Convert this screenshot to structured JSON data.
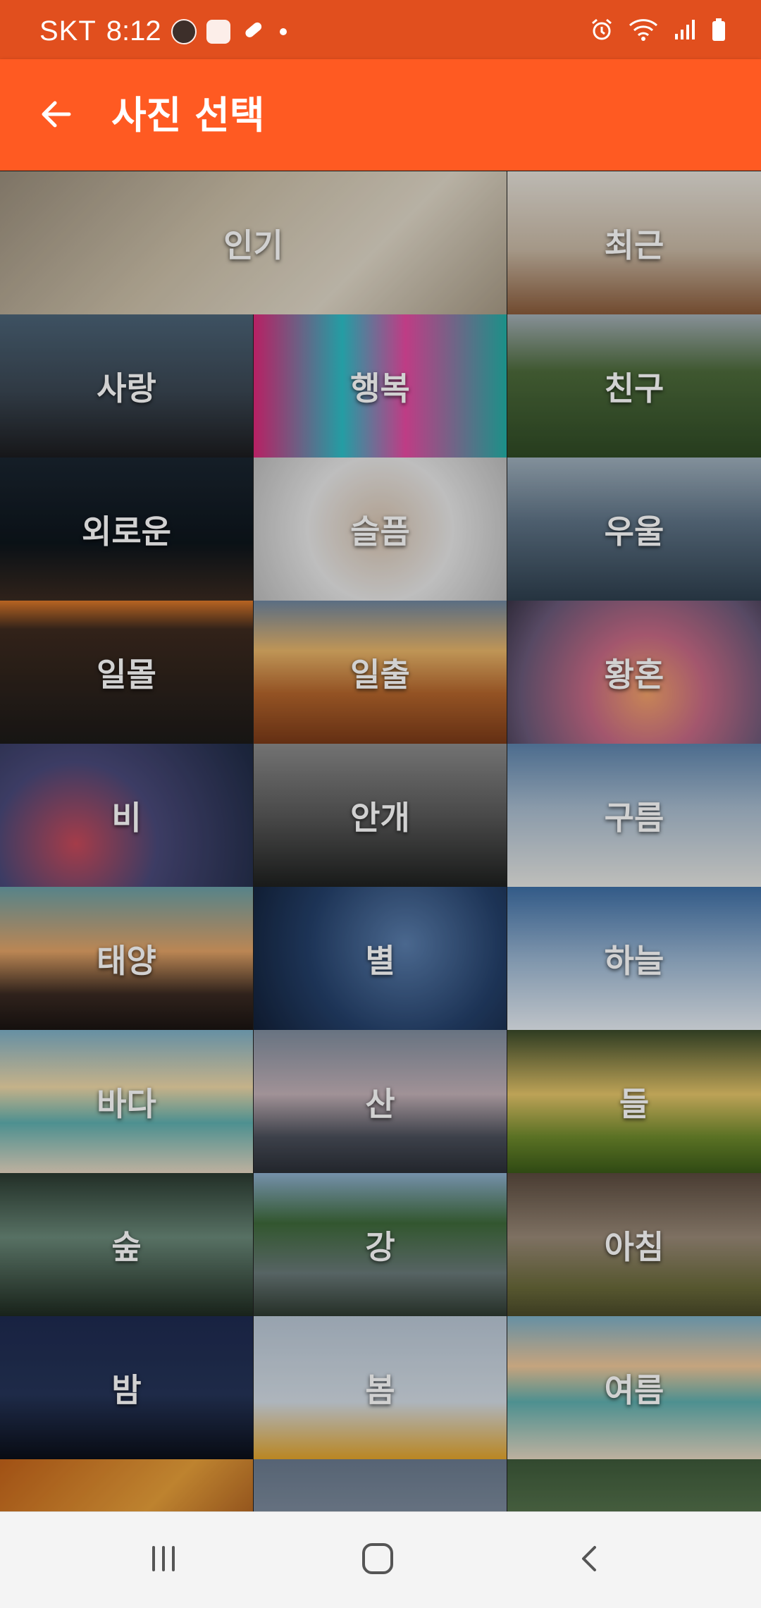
{
  "status_bar": {
    "carrier": "SKT",
    "time": "8:12"
  },
  "app_bar": {
    "title": "사진 선택",
    "back_icon": "arrow-left-icon"
  },
  "colors": {
    "status_bar": "#e14f1e",
    "app_bar": "#ff5a22",
    "tile_text": "#ffffff"
  },
  "categories": [
    "인기",
    "최근",
    "사랑",
    "행복",
    "친구",
    "외로운",
    "슬픔",
    "우울",
    "일몰",
    "일출",
    "황혼",
    "비",
    "안개",
    "구름",
    "태양",
    "별",
    "하늘",
    "바다",
    "산",
    "들",
    "숲",
    "강",
    "아침",
    "밤",
    "봄",
    "여름"
  ],
  "nav_bar": {
    "recent_icon": "recent-apps-icon",
    "home_icon": "home-icon",
    "back_icon": "back-chevron-icon"
  }
}
